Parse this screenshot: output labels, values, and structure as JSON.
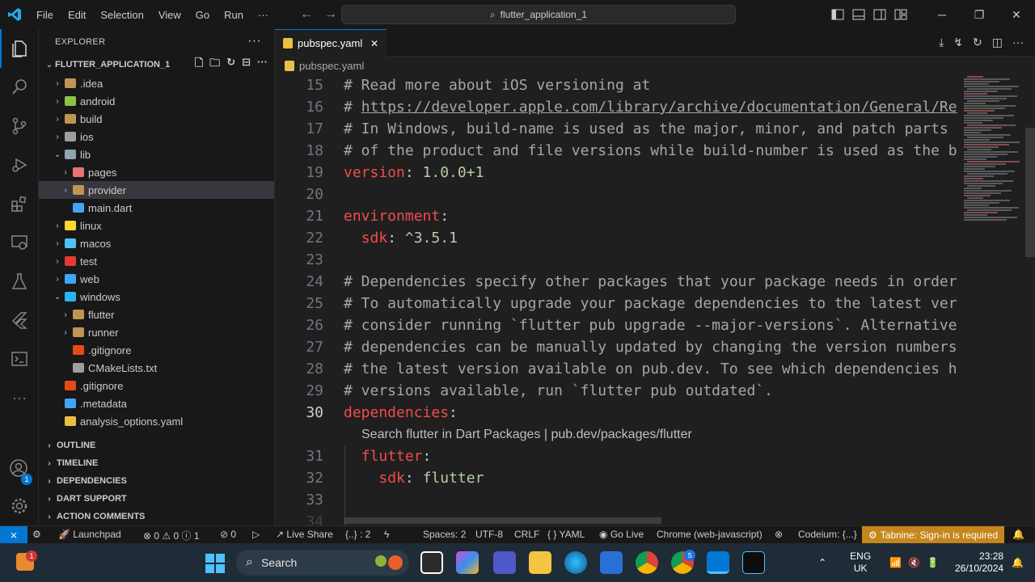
{
  "titlebar": {
    "menu": [
      "File",
      "Edit",
      "Selection",
      "View",
      "Go",
      "Run"
    ],
    "more": "···",
    "search_text": "flutter_application_1"
  },
  "sidebar": {
    "title": "EXPLORER",
    "more": "···",
    "folder_name": "FLUTTER_APPLICATION_1",
    "tree": [
      {
        "label": ".idea",
        "indent": 1,
        "chev": "›",
        "icon": "#c09553"
      },
      {
        "label": "android",
        "indent": 1,
        "chev": "›",
        "icon": "#8bc34a"
      },
      {
        "label": "build",
        "indent": 1,
        "chev": "›",
        "icon": "#c09553"
      },
      {
        "label": "ios",
        "indent": 1,
        "chev": "›",
        "icon": "#9e9e9e"
      },
      {
        "label": "lib",
        "indent": 1,
        "chev": "⌄",
        "icon": "#90a4ae"
      },
      {
        "label": "pages",
        "indent": 2,
        "chev": "›",
        "icon": "#e57373"
      },
      {
        "label": "provider",
        "indent": 2,
        "chev": "›",
        "icon": "#c09553",
        "selected": true
      },
      {
        "label": "main.dart",
        "indent": 2,
        "chev": "",
        "icon": "#42a5f5"
      },
      {
        "label": "linux",
        "indent": 1,
        "chev": "›",
        "icon": "#fdd835"
      },
      {
        "label": "macos",
        "indent": 1,
        "chev": "›",
        "icon": "#4fc3f7"
      },
      {
        "label": "test",
        "indent": 1,
        "chev": "›",
        "icon": "#e53935"
      },
      {
        "label": "web",
        "indent": 1,
        "chev": "›",
        "icon": "#42a5f5"
      },
      {
        "label": "windows",
        "indent": 1,
        "chev": "⌄",
        "icon": "#29b6f6"
      },
      {
        "label": "flutter",
        "indent": 2,
        "chev": "›",
        "icon": "#c09553"
      },
      {
        "label": "runner",
        "indent": 2,
        "chev": "›",
        "icon": "#c09553"
      },
      {
        "label": ".gitignore",
        "indent": 2,
        "chev": "",
        "icon": "#e64a19"
      },
      {
        "label": "CMakeLists.txt",
        "indent": 2,
        "chev": "",
        "icon": "#9e9e9e"
      },
      {
        "label": ".gitignore",
        "indent": 1,
        "chev": "",
        "icon": "#e64a19"
      },
      {
        "label": ".metadata",
        "indent": 1,
        "chev": "",
        "icon": "#42a5f5"
      },
      {
        "label": "analysis_options.yaml",
        "indent": 1,
        "chev": "",
        "icon": "#e9c046"
      }
    ],
    "sections": [
      "OUTLINE",
      "TIMELINE",
      "DEPENDENCIES",
      "DART SUPPORT",
      "ACTION COMMENTS"
    ]
  },
  "editor": {
    "tab_label": "pubspec.yaml",
    "tab_close": "✕",
    "breadcrumb": "pubspec.yaml",
    "lines": [
      {
        "n": "15",
        "parts": [
          [
            "cmd",
            "# Read more about iOS versioning at"
          ]
        ]
      },
      {
        "n": "16",
        "parts": [
          [
            "cmd",
            "# "
          ],
          [
            "url",
            "https://developer.apple.com/library/archive/documentation/General/Re"
          ]
        ]
      },
      {
        "n": "17",
        "parts": [
          [
            "cmd",
            "# In Windows, build-name is used as the major, minor, and patch parts"
          ]
        ]
      },
      {
        "n": "18",
        "parts": [
          [
            "cmd",
            "# of the product and file versions while build-number is used as the b"
          ]
        ]
      },
      {
        "n": "19",
        "parts": [
          [
            "key2",
            "version"
          ],
          [
            "plain",
            ": "
          ],
          [
            "val",
            "1.0.0+1"
          ]
        ]
      },
      {
        "n": "20",
        "parts": []
      },
      {
        "n": "21",
        "parts": [
          [
            "key2",
            "environment"
          ],
          [
            "plain",
            ":"
          ]
        ]
      },
      {
        "n": "22",
        "parts": [
          [
            "plain",
            "  "
          ],
          [
            "key2",
            "sdk"
          ],
          [
            "plain",
            ": "
          ],
          [
            "val",
            "^3.5.1"
          ]
        ]
      },
      {
        "n": "23",
        "parts": []
      },
      {
        "n": "24",
        "parts": [
          [
            "cmd",
            "# Dependencies specify other packages that your package needs in order"
          ]
        ]
      },
      {
        "n": "25",
        "parts": [
          [
            "cmd",
            "# To automatically upgrade your package dependencies to the latest ver"
          ]
        ]
      },
      {
        "n": "26",
        "parts": [
          [
            "cmd",
            "# consider running `flutter pub upgrade --major-versions`. Alternative"
          ]
        ]
      },
      {
        "n": "27",
        "parts": [
          [
            "cmd",
            "# dependencies can be manually updated by changing the version numbers"
          ]
        ]
      },
      {
        "n": "28",
        "parts": [
          [
            "cmd",
            "# the latest version available on pub.dev. To see which dependencies h"
          ]
        ]
      },
      {
        "n": "29",
        "parts": [
          [
            "cmd",
            "# versions available, run `flutter pub outdated`."
          ]
        ]
      },
      {
        "n": "30",
        "parts": [
          [
            "key2",
            "dependencies"
          ],
          [
            "plain",
            ":"
          ]
        ],
        "current": true
      },
      {
        "n": "",
        "lens": "Search flutter in Dart Packages | pub.dev/packages/flutter"
      },
      {
        "n": "31",
        "parts": [
          [
            "plain",
            "  "
          ],
          [
            "key2",
            "flutter"
          ],
          [
            "plain",
            ":"
          ]
        ]
      },
      {
        "n": "32",
        "parts": [
          [
            "plain",
            "    "
          ],
          [
            "key2",
            "sdk"
          ],
          [
            "plain",
            ": "
          ],
          [
            "val",
            "flutter"
          ]
        ]
      },
      {
        "n": "33",
        "parts": []
      },
      {
        "n": "34",
        "parts": []
      }
    ]
  },
  "statusbar": {
    "remote": "⨯",
    "launchpad": "Launchpad",
    "problems": "⊗ 0 ⚠ 0 ⓘ 1",
    "ports": "0",
    "live_share": "Live Share",
    "braces": "{..} : 2",
    "spaces": "Spaces: 2",
    "encoding": "UTF-8",
    "eol": "CRLF",
    "language": "YAML",
    "go_live": "Go Live",
    "device": "Chrome (web-javascript)",
    "codeium": "Codeium: {...}",
    "tabnine": "Tabnine: Sign-in is required"
  },
  "taskbar": {
    "search_label": "Search",
    "lang_top": "ENG",
    "lang_bottom": "UK",
    "time": "23:28",
    "date": "26/10/2024",
    "weather_badge": "1",
    "chrome_badge": "S"
  },
  "colors": {
    "accent": "#0078d4",
    "tabnine": "#c5861b",
    "key": "#f14c4c",
    "value": "#b5cea8"
  },
  "accounts_badge": "1"
}
